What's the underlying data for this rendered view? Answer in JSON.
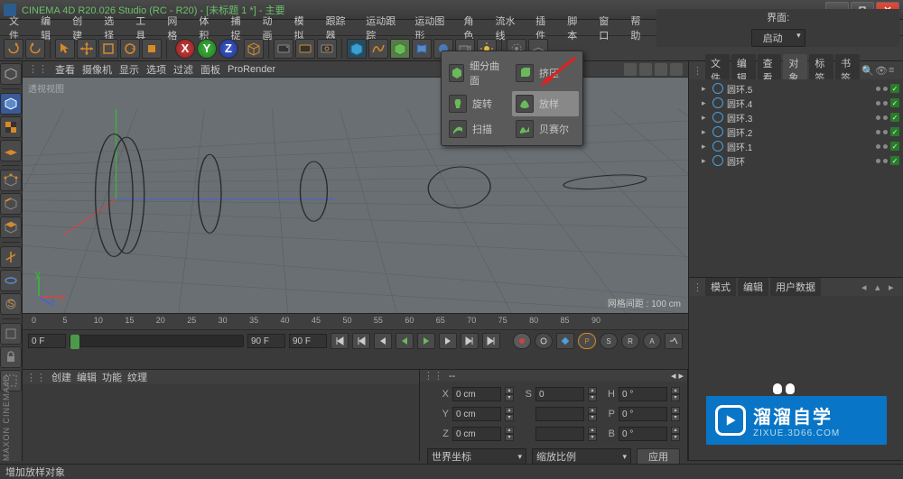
{
  "title": "CINEMA 4D R20.026 Studio (RC - R20) - [未标题 1 *] - 主要",
  "menu": [
    "文件",
    "编辑",
    "创建",
    "选择",
    "工具",
    "网格",
    "体积",
    "捕捉",
    "动画",
    "模拟",
    "跟踪器",
    "运动跟踪",
    "运动图形",
    "角色",
    "流水线",
    "插件",
    "脚本",
    "窗口",
    "帮助"
  ],
  "layout_label": "界面:",
  "layout_value": "启动",
  "viewport_menu": [
    "查看",
    "摄像机",
    "显示",
    "选项",
    "过滤",
    "面板",
    "ProRender"
  ],
  "viewport_name": "透视视图",
  "viewport_focal": "网格间距 : 100 cm",
  "objects_tabs": [
    "文件",
    "编辑",
    "查看",
    "对象",
    "标签",
    "书签"
  ],
  "objects": [
    {
      "name": "圆环.5"
    },
    {
      "name": "圆环.4"
    },
    {
      "name": "圆环.3"
    },
    {
      "name": "圆环.2"
    },
    {
      "name": "圆环.1"
    },
    {
      "name": "圆环"
    }
  ],
  "attr_tabs": [
    "模式",
    "编辑",
    "用户数据"
  ],
  "coords_tab": "--",
  "coord_labels": {
    "x": "X",
    "y": "Y",
    "z": "Z",
    "sx": "S",
    "sy": "H",
    "sz": "B",
    "p": "P"
  },
  "coord_vals": {
    "x": "0 cm",
    "y": "0 cm",
    "z": "0 cm",
    "sx": "0",
    "sy": "0 °",
    "sz": "0 °",
    "p": "0 °"
  },
  "coord_mode1": "世界坐标",
  "coord_mode2": "缩放比例",
  "apply": "应用",
  "timeline": {
    "start": "0 F",
    "end": "90 F",
    "cur": "0",
    "max": "90 F",
    "ticks": [
      0,
      5,
      10,
      15,
      20,
      25,
      30,
      35,
      40,
      45,
      50,
      55,
      60,
      65,
      70,
      75,
      80,
      85,
      90
    ]
  },
  "cmd_tabs": [
    "创建",
    "编辑",
    "功能",
    "纹理"
  ],
  "popup": {
    "items": [
      {
        "label": "细分曲面",
        "row": 0
      },
      {
        "label": "挤压",
        "row": 0
      },
      {
        "label": "旋转",
        "row": 1
      },
      {
        "label": "放样",
        "row": 1
      },
      {
        "label": "扫描",
        "row": 2
      },
      {
        "label": "贝赛尔",
        "row": 2
      }
    ]
  },
  "status": "增加放样对象",
  "watermark": {
    "cn": "溜溜自学",
    "url": "ZIXUE.3D66.COM"
  },
  "brand": "MAXON\nCINEMA4D"
}
